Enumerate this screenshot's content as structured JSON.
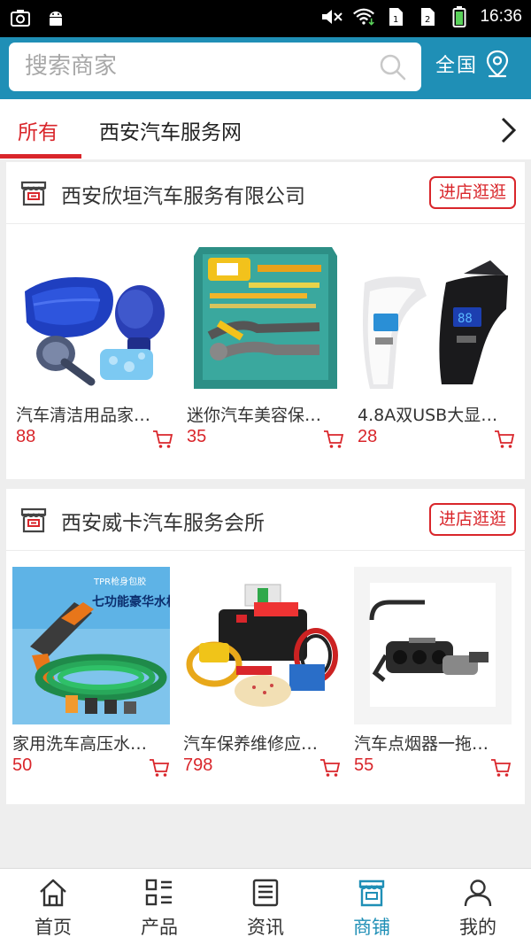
{
  "status_bar": {
    "time": "16:36",
    "icons": [
      "screenshot-icon",
      "android-icon",
      "mute-icon",
      "wifi-icon",
      "sim1-icon",
      "sim2-icon",
      "battery-icon"
    ]
  },
  "header": {
    "search_placeholder": "搜索商家",
    "region_label": "全国"
  },
  "tabs": [
    {
      "label": "所有",
      "active": true
    },
    {
      "label": "西安汽车服务网",
      "active": false
    }
  ],
  "stores": [
    {
      "name": "西安欣垣汽车服务有限公司",
      "enter_label": "进店逛逛",
      "products": [
        {
          "name": "汽车清洁用品家…",
          "price": "88"
        },
        {
          "name": "迷你汽车美容保…",
          "price": "35"
        },
        {
          "name": "4.8A双USB大显…",
          "price": "28"
        }
      ]
    },
    {
      "name": "西安威卡汽车服务会所",
      "enter_label": "进店逛逛",
      "products": [
        {
          "name": "家用洗车高压水…",
          "price": "50"
        },
        {
          "name": "汽车保养维修应…",
          "price": "798"
        },
        {
          "name": "汽车点烟器一拖…",
          "price": "55"
        }
      ]
    }
  ],
  "product_image_text": {
    "water_gun_top": "TPR枪身包胶",
    "water_gun_title": "七功能豪华水枪"
  },
  "bottom_nav": [
    {
      "label": "首页",
      "icon": "home-icon",
      "active": false
    },
    {
      "label": "产品",
      "icon": "grid-list-icon",
      "active": false
    },
    {
      "label": "资讯",
      "icon": "news-icon",
      "active": false
    },
    {
      "label": "商铺",
      "icon": "store-icon",
      "active": true
    },
    {
      "label": "我的",
      "icon": "user-icon",
      "active": false
    }
  ],
  "colors": {
    "header_bg": "#1f8fb6",
    "accent_red": "#d9262b",
    "active_nav": "#1f8fb6"
  }
}
